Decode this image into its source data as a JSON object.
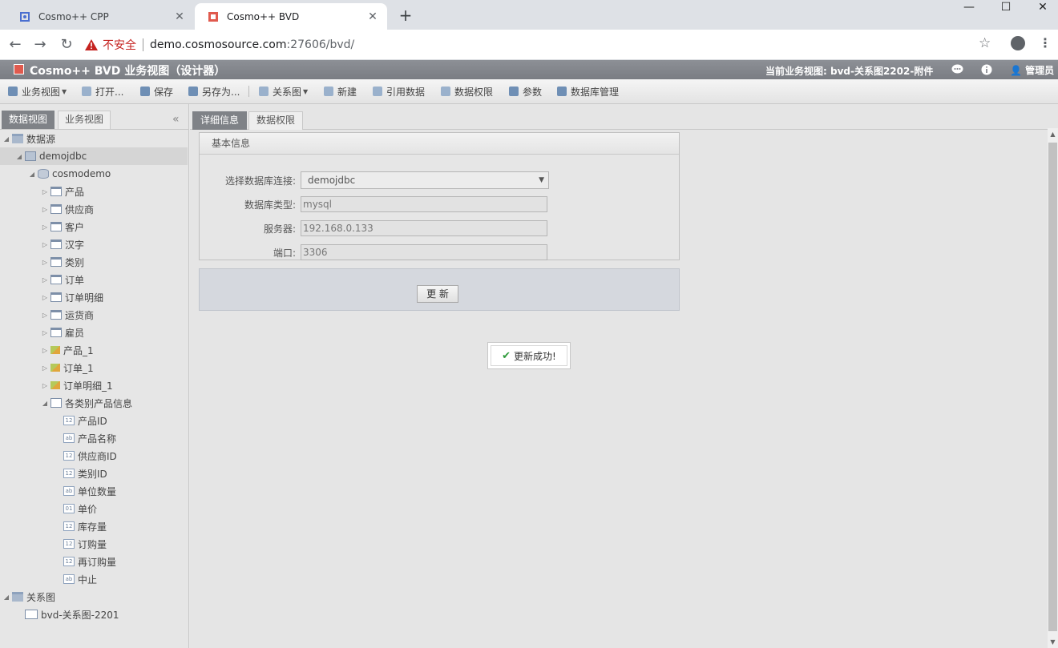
{
  "browser": {
    "tabs": [
      {
        "title": "Cosmo++ CPP",
        "active": false
      },
      {
        "title": "Cosmo++ BVD",
        "active": true
      }
    ],
    "insecure_label": "不安全",
    "url_host": "demo.cosmosource.com",
    "url_rest": ":27606/bvd/"
  },
  "app": {
    "title": "Cosmo++ BVD 业务视图（设计器）",
    "current_view": "当前业务视图: bvd-关系图2202-附件",
    "user": "管理员"
  },
  "toolbar": [
    {
      "label": "业务视图",
      "dropdown": true
    },
    {
      "label": "打开...",
      "dropdown": false
    },
    {
      "label": "保存",
      "dropdown": false
    },
    {
      "label": "另存为...",
      "dropdown": false
    },
    {
      "label": "关系图",
      "dropdown": true
    },
    {
      "label": "新建",
      "dropdown": false
    },
    {
      "label": "引用数据",
      "dropdown": false
    },
    {
      "label": "数据权限",
      "dropdown": false
    },
    {
      "label": "参数",
      "dropdown": false
    },
    {
      "label": "数据库管理",
      "dropdown": false
    }
  ],
  "left_tabs": [
    "数据视图",
    "业务视图"
  ],
  "tree": [
    {
      "label": "数据源",
      "indent": 0,
      "icon": "folder",
      "toggle": "open"
    },
    {
      "label": "demojdbc",
      "indent": 1,
      "icon": "server",
      "toggle": "open",
      "selected": true
    },
    {
      "label": "cosmodemo",
      "indent": 2,
      "icon": "db",
      "toggle": "open"
    },
    {
      "label": "产品",
      "indent": 3,
      "icon": "table",
      "toggle": "closed"
    },
    {
      "label": "供应商",
      "indent": 3,
      "icon": "table",
      "toggle": "closed"
    },
    {
      "label": "客户",
      "indent": 3,
      "icon": "table",
      "toggle": "closed"
    },
    {
      "label": "汉字",
      "indent": 3,
      "icon": "table",
      "toggle": "closed"
    },
    {
      "label": "类别",
      "indent": 3,
      "icon": "table",
      "toggle": "closed"
    },
    {
      "label": "订单",
      "indent": 3,
      "icon": "table",
      "toggle": "closed"
    },
    {
      "label": "订单明细",
      "indent": 3,
      "icon": "table",
      "toggle": "closed"
    },
    {
      "label": "运货商",
      "indent": 3,
      "icon": "table",
      "toggle": "closed"
    },
    {
      "label": "雇员",
      "indent": 3,
      "icon": "table",
      "toggle": "closed"
    },
    {
      "label": "产品_1",
      "indent": 3,
      "icon": "edit",
      "toggle": "closed"
    },
    {
      "label": "订单_1",
      "indent": 3,
      "icon": "edit",
      "toggle": "closed"
    },
    {
      "label": "订单明细_1",
      "indent": 3,
      "icon": "edit",
      "toggle": "closed"
    },
    {
      "label": "各类别产品信息",
      "indent": 3,
      "icon": "view",
      "toggle": "open"
    },
    {
      "label": "产品ID",
      "indent": 4,
      "icon": "field",
      "tag": "12"
    },
    {
      "label": "产品名称",
      "indent": 4,
      "icon": "field",
      "tag": "ab"
    },
    {
      "label": "供应商ID",
      "indent": 4,
      "icon": "field",
      "tag": "12"
    },
    {
      "label": "类别ID",
      "indent": 4,
      "icon": "field",
      "tag": "12"
    },
    {
      "label": "单位数量",
      "indent": 4,
      "icon": "field",
      "tag": "ab"
    },
    {
      "label": "单价",
      "indent": 4,
      "icon": "field",
      "tag": "01"
    },
    {
      "label": "库存量",
      "indent": 4,
      "icon": "field",
      "tag": "12"
    },
    {
      "label": "订购量",
      "indent": 4,
      "icon": "field",
      "tag": "12"
    },
    {
      "label": "再订购量",
      "indent": 4,
      "icon": "field",
      "tag": "12"
    },
    {
      "label": "中止",
      "indent": 4,
      "icon": "field",
      "tag": "ab"
    },
    {
      "label": "关系图",
      "indent": 0,
      "icon": "folder",
      "toggle": "open"
    },
    {
      "label": "bvd-关系图-2201",
      "indent": 1,
      "icon": "rel"
    }
  ],
  "main_tabs": [
    "详细信息",
    "数据权限"
  ],
  "form": {
    "legend": "基本信息",
    "db_conn_label": "选择数据库连接:",
    "db_conn_value": "demojdbc",
    "db_type_label": "数据库类型:",
    "db_type_value": "mysql",
    "server_label": "服务器:",
    "server_value": "192.168.0.133",
    "port_label": "端口:",
    "port_value": "3306",
    "update_button": "更 新"
  },
  "toast": "更新成功!"
}
